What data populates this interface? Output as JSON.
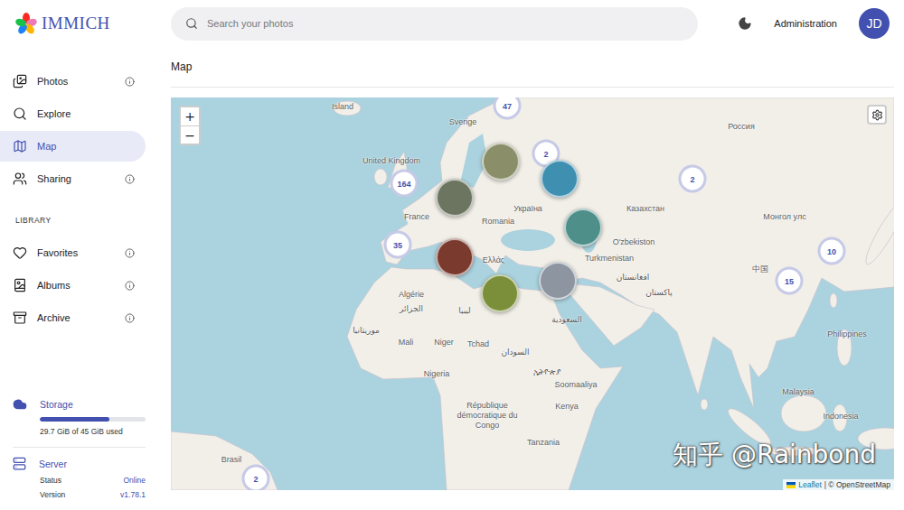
{
  "header": {
    "logo": "IMMICH",
    "search_placeholder": "Search your photos",
    "admin_link": "Administration",
    "avatar": "JD"
  },
  "sidebar": {
    "items": [
      {
        "label": "Photos",
        "selected": false,
        "info": true
      },
      {
        "label": "Explore",
        "selected": false,
        "info": false
      },
      {
        "label": "Map",
        "selected": true,
        "info": false
      },
      {
        "label": "Sharing",
        "selected": false,
        "info": true
      }
    ],
    "library_heading": "LIBRARY",
    "library_items": [
      {
        "label": "Favorites",
        "selected": false,
        "info": true
      },
      {
        "label": "Albums",
        "selected": false,
        "info": true
      },
      {
        "label": "Archive",
        "selected": false,
        "info": true
      }
    ],
    "storage": {
      "title": "Storage",
      "level": 0.66,
      "usage": "29.7 GiB of 45 GiB used"
    },
    "server": {
      "title": "Server",
      "rows": [
        {
          "label": "Status",
          "value": "Online"
        },
        {
          "label": "Version",
          "value": "v1.78.1"
        }
      ]
    }
  },
  "page": {
    "title": "Map"
  },
  "map": {
    "zoom_in": "+",
    "zoom_out": "−",
    "attribution": {
      "brand": "Leaflet",
      "rest": "| © OpenStreetMap"
    },
    "clusters": [
      {
        "kind": "count",
        "count": "47"
      },
      {
        "kind": "count",
        "count": "2"
      },
      {
        "kind": "count",
        "count": "164"
      },
      {
        "kind": "count",
        "count": "2"
      },
      {
        "kind": "count",
        "count": "35"
      },
      {
        "kind": "count",
        "count": "10"
      },
      {
        "kind": "count",
        "count": "15"
      },
      {
        "kind": "count",
        "count": "2"
      },
      {
        "kind": "photo"
      },
      {
        "kind": "photo"
      },
      {
        "kind": "photo"
      },
      {
        "kind": "photo"
      },
      {
        "kind": "photo"
      },
      {
        "kind": "photo"
      },
      {
        "kind": "photo"
      }
    ],
    "labels": [
      "Island",
      "Sverige",
      "Россия",
      "United Kingdom",
      "France",
      "Romania",
      "Україна",
      "Казахстан",
      "Монгол улс",
      "Ελλάς",
      "O'zbekiston",
      "Turkmenistan",
      "中国",
      "Algérie",
      "الجزائر",
      "ليبيا",
      "افغانستان",
      "پاکستان",
      "السعودية",
      "موريتانيا",
      "Mali",
      "Niger",
      "Tchad",
      "السودان",
      "Nigeria",
      "ኢትዮጵያ",
      "Soomaaliya",
      "Philippines",
      "Kenya",
      "République démocratique du Congo",
      "Tanzania",
      "Malaysia",
      "Indonesia",
      "Brasil"
    ]
  },
  "watermark": "知乎 @Rainbond"
}
